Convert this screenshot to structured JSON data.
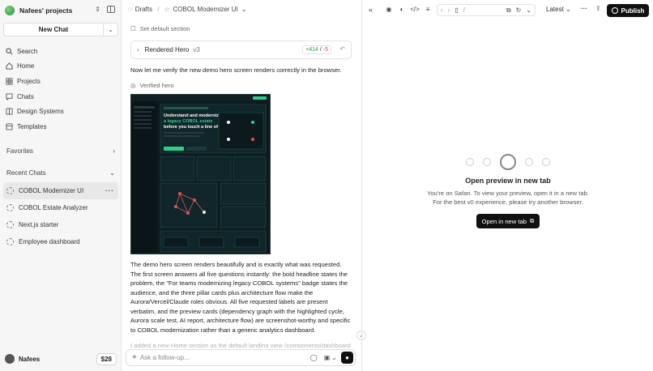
{
  "sidebar": {
    "project_name": "Nafees' projects",
    "new_chat_label": "New Chat",
    "nav": [
      {
        "label": "Search",
        "icon": "search-icon"
      },
      {
        "label": "Home",
        "icon": "home-icon"
      },
      {
        "label": "Projects",
        "icon": "grid-icon"
      },
      {
        "label": "Chats",
        "icon": "chat-icon"
      },
      {
        "label": "Design Systems",
        "icon": "palette-icon"
      },
      {
        "label": "Templates",
        "icon": "template-icon"
      }
    ],
    "favorites_label": "Favorites",
    "recent_label": "Recent Chats",
    "recent": [
      {
        "label": "COBOL Modernizer UI"
      },
      {
        "label": "COBOL Estate Analyzer"
      },
      {
        "label": "Next.js starter"
      },
      {
        "label": "Employee dashboard"
      }
    ],
    "user_name": "Nafees",
    "credit": "$28"
  },
  "chat": {
    "breadcrumb_drafts": "Drafts",
    "breadcrumb_title": "COBOL Modernizer UI",
    "set_default": "Set default section",
    "card_title": "Rendered Hero",
    "card_version": "v3",
    "diff_plus": "+414",
    "diff_sep": "/",
    "diff_minus": "-5",
    "msg1": "Now let me verify the new demo hero screen renders correctly in the browser.",
    "verified": "Verified hero",
    "msg2": "The demo hero screen renders beautifully and is exactly what was requested. The first screen answers all five questions instantly: the bold headline states the problem, the \"For teams modernizing legacy COBOL systems\" badge states the audience, and the three pillar cards plus architecture flow make the Aurora/Vercel/Claude roles obvious. All five requested labels are present verbatim, and the preview cards (dependency graph with the highlighted cycle, Aurora scale test, AI report, architecture flow) are screenshot-worthy and specific to COBOL modernization rather than a generic analytics dashboard.",
    "msg3": "I added a new Home section as the default landing view (components/dashboard",
    "composer_placeholder": "Ask a follow-up...",
    "shot": {
      "headline_1": "Understand and modernize",
      "headline_2": "a legacy COBOL estate",
      "headline_3": "before you touch a line of it."
    }
  },
  "preview": {
    "url_text": "/",
    "latest_label": "Latest",
    "publish_label": "Publish",
    "empty_title": "Open preview in new tab",
    "empty_desc_1": "You're on Safari. To view your preview, open it in a new tab.",
    "empty_desc_2": "For the best v0 experience, please try another browser.",
    "open_button": "Open in new tab"
  },
  "colors": {
    "accent": "#111111",
    "plus": "#1e9e4a",
    "minus": "#d93a3a",
    "shot_bg": "#0d1a1d",
    "shot_highlight": "#2fcf8a"
  }
}
